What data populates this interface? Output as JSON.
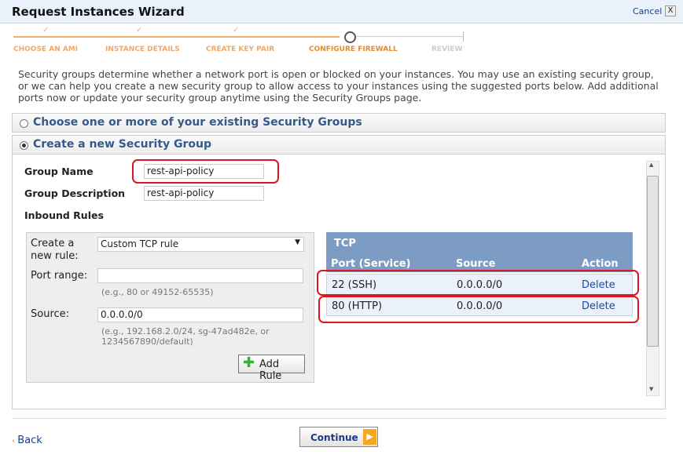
{
  "window": {
    "title": "Request Instances Wizard",
    "cancel": "Cancel",
    "close": "X"
  },
  "steps": [
    {
      "label": "CHOOSE AN AMI",
      "state": "done"
    },
    {
      "label": "INSTANCE DETAILS",
      "state": "done"
    },
    {
      "label": "CREATE KEY PAIR",
      "state": "done"
    },
    {
      "label": "CONFIGURE FIREWALL",
      "state": "current"
    },
    {
      "label": "REVIEW",
      "state": "pending"
    }
  ],
  "description": "Security groups determine whether a network port is open or blocked on your instances. You may use an existing security group, or we can help you create a new security group to allow access to your instances using the suggested ports below. Add additional ports now or update your security group anytime using the Security Groups page.",
  "options": {
    "existing": "Choose one or more of your existing Security Groups",
    "create": "Create a new Security Group",
    "selected": "create"
  },
  "form": {
    "group_name_label": "Group Name",
    "group_name": "rest-api-policy",
    "group_desc_label": "Group Description",
    "group_desc": "rest-api-policy",
    "inbound_label": "Inbound Rules",
    "create_rule_label": "Create a new rule:",
    "rule_type": "Custom TCP rule",
    "port_range_label": "Port range:",
    "port_range": "",
    "port_hint": "(e.g., 80 or 49152-65535)",
    "source_label": "Source:",
    "source": "0.0.0.0/0",
    "source_hint": "(e.g., 192.168.2.0/24, sg-47ad482e, or 1234567890/default)",
    "add_rule": "Add Rule"
  },
  "rules_table": {
    "title": "TCP",
    "headers": [
      "Port (Service)",
      "Source",
      "Action"
    ],
    "rows": [
      {
        "port": "22 (SSH)",
        "source": "0.0.0.0/0",
        "action": "Delete"
      },
      {
        "port": "80 (HTTP)",
        "source": "0.0.0.0/0",
        "action": "Delete"
      }
    ]
  },
  "footer": {
    "back": "Back",
    "continue": "Continue"
  }
}
